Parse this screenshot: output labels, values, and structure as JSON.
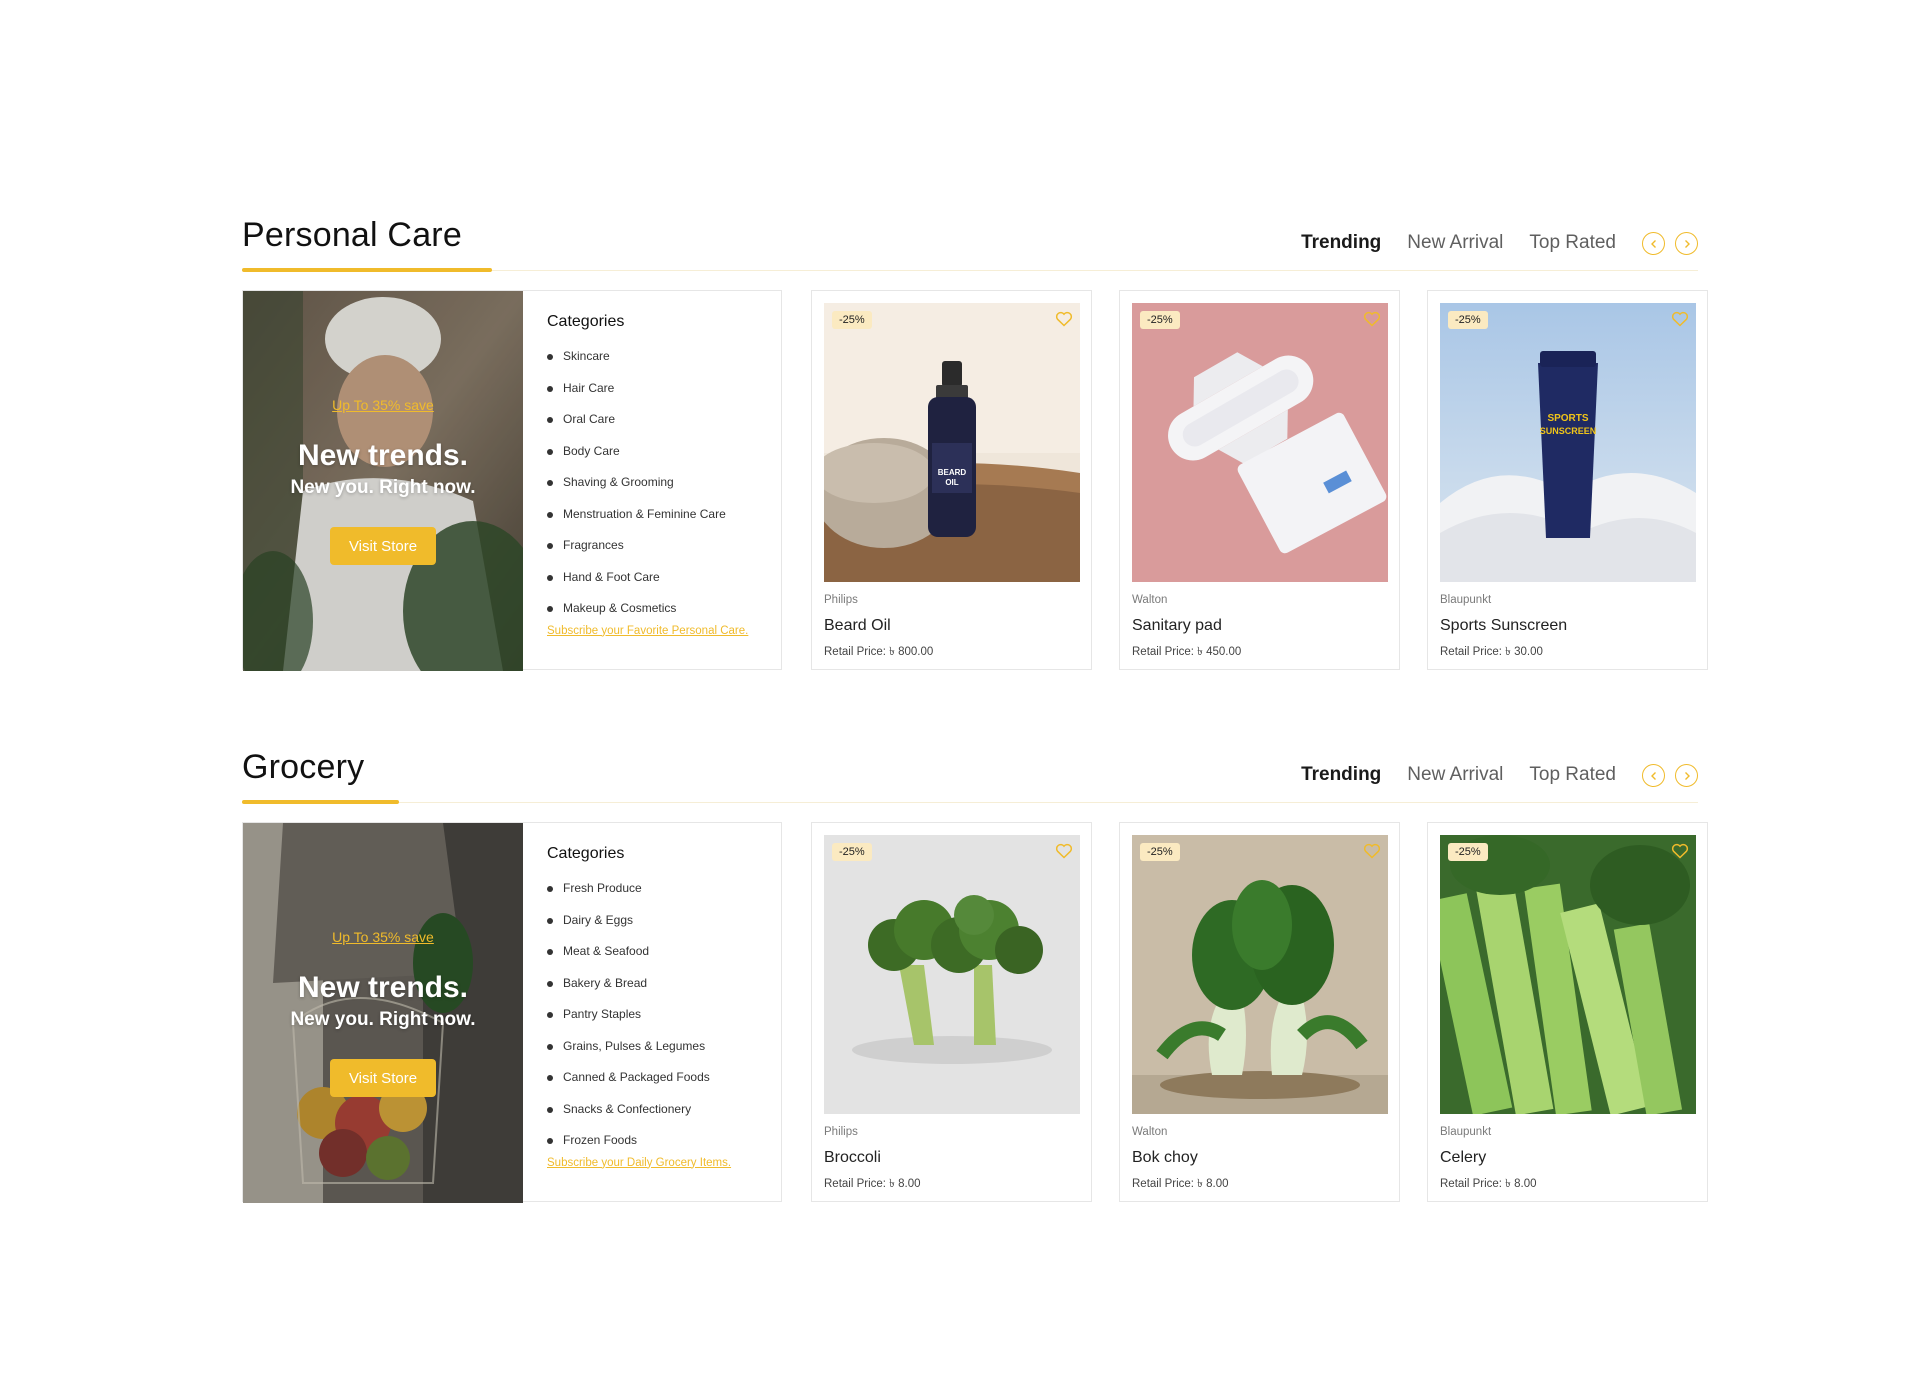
{
  "colors": {
    "accent": "#f0bb2b",
    "badge_bg": "#fbeac1",
    "border": "#e6e6e6"
  },
  "sections": [
    {
      "title": "Personal Care",
      "tabs": [
        "Trending",
        "New Arrival",
        "Top Rated"
      ],
      "active_tab": "Trending",
      "promo": {
        "save_text": "Up To 35% save",
        "headline": "New trends.",
        "subheadline": "New you. Right now.",
        "button_label": "Visit Store"
      },
      "categories": {
        "title": "Categories",
        "items": [
          "Skincare",
          "Hair Care",
          "Oral Care",
          "Body Care",
          "Shaving & Grooming",
          "Menstruation & Feminine Care",
          "Fragrances",
          "Hand & Foot Care",
          "Makeup & Cosmetics"
        ],
        "subscribe_link": "Subscribe your Favorite Personal Care."
      },
      "products": [
        {
          "badge": "-25%",
          "brand": "Philips",
          "name": "Beard Oil",
          "price": "Retail Price: ৳ 800.00",
          "image_icon": "beard-oil-bottle"
        },
        {
          "badge": "-25%",
          "brand": "Walton",
          "name": "Sanitary pad",
          "price": "Retail Price: ৳ 450.00",
          "image_icon": "sanitary-pad"
        },
        {
          "badge": "-25%",
          "brand": "Blaupunkt",
          "name": "Sports Sunscreen",
          "price": "Retail Price: ৳ 30.00",
          "image_icon": "sunscreen-tube"
        }
      ]
    },
    {
      "title": "Grocery",
      "tabs": [
        "Trending",
        "New Arrival",
        "Top Rated"
      ],
      "active_tab": "Trending",
      "promo": {
        "save_text": "Up To 35% save",
        "headline": "New trends.",
        "subheadline": "New you. Right now.",
        "button_label": "Visit Store"
      },
      "categories": {
        "title": "Categories",
        "items": [
          "Fresh Produce",
          "Dairy & Eggs",
          "Meat & Seafood",
          "Bakery & Bread",
          "Pantry Staples",
          "Grains, Pulses & Legumes",
          "Canned & Packaged Foods",
          "Snacks & Confectionery",
          "Frozen Foods"
        ],
        "subscribe_link": "Subscribe your Daily Grocery Items."
      },
      "products": [
        {
          "badge": "-25%",
          "brand": "Philips",
          "name": "Broccoli",
          "price": "Retail Price: ৳ 8.00",
          "image_icon": "broccoli"
        },
        {
          "badge": "-25%",
          "brand": "Walton",
          "name": "Bok choy",
          "price": "Retail Price: ৳ 8.00",
          "image_icon": "bok-choy"
        },
        {
          "badge": "-25%",
          "brand": "Blaupunkt",
          "name": "Celery",
          "price": "Retail Price: ৳ 8.00",
          "image_icon": "celery"
        }
      ]
    }
  ]
}
